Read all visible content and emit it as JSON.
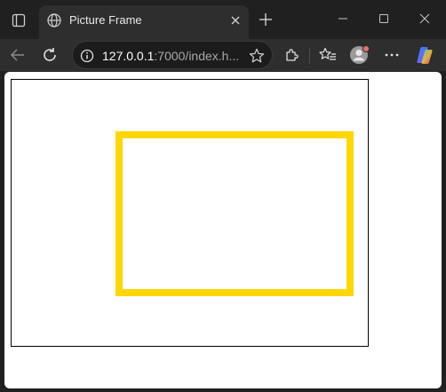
{
  "browser": {
    "tab": {
      "title": "Picture Frame",
      "favicon": "globe-icon"
    },
    "address_bar": {
      "url_host": "127.0.0.1",
      "url_rest": ":7000/index.h...",
      "security_icon": "info-icon"
    },
    "toolbar_icons": [
      "back-icon",
      "reload-icon",
      "star-icon",
      "extensions-icon",
      "favorites-icon",
      "profile-avatar",
      "more-icon",
      "copilot-icon"
    ],
    "window_controls": [
      "minimize-icon",
      "maximize-icon",
      "close-icon"
    ]
  },
  "page": {
    "canvas": {
      "border_color": "#000000",
      "background": "#ffffff"
    },
    "frame": {
      "border_color": "#ffd700",
      "fill": "transparent"
    }
  },
  "colors": {
    "chrome_dark": "#202020",
    "toolbar": "#2e2e2e",
    "accent_yellow": "#ffd700",
    "profile_badge": "#e8736c"
  }
}
